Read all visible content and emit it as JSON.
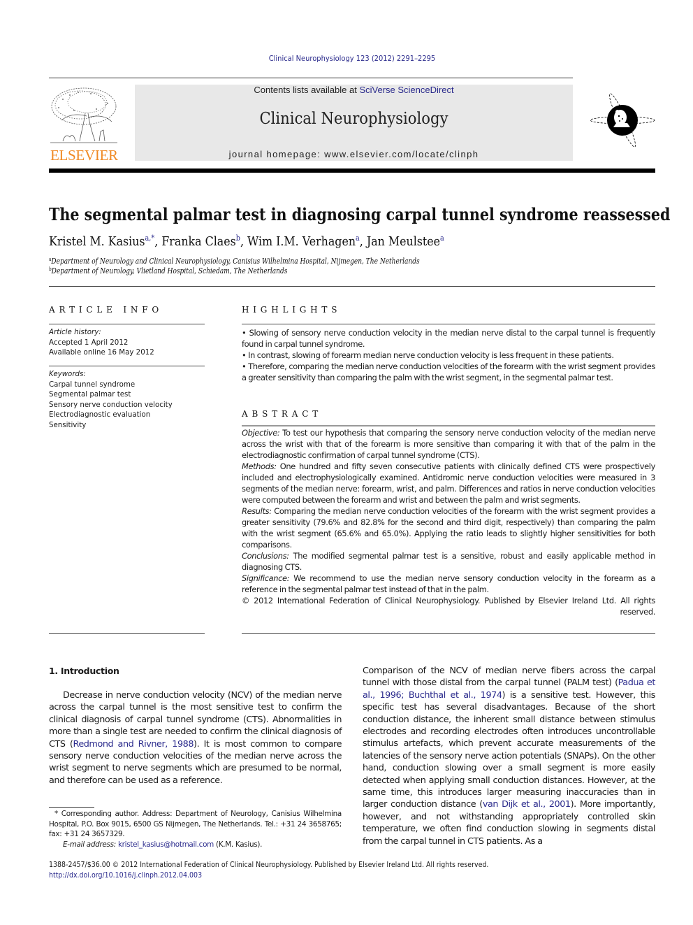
{
  "header": {
    "journal_reference": "Clinical Neurophysiology 123 (2012) 2291–2295",
    "contents_prefix": "Contents lists available at ",
    "contents_link": "SciVerse ScienceDirect",
    "journal_name": "Clinical Neurophysiology",
    "homepage": "journal homepage: www.elsevier.com/locate/clinph",
    "publisher_logo_text": "ELSEVIER",
    "colors": {
      "publisher": "#f08a24",
      "link": "#2a2a8c",
      "banner_bg": "#e8e8e8"
    }
  },
  "article": {
    "title": "The segmental palmar test in diagnosing carpal tunnel syndrome reassessed",
    "authors": [
      {
        "name": "Kristel M. Kasius",
        "sup": "a,*"
      },
      {
        "name": "Franka Claes",
        "sup": "b"
      },
      {
        "name": "Wim I.M. Verhagen",
        "sup": "a"
      },
      {
        "name": "Jan Meulstee",
        "sup": "a"
      }
    ],
    "affiliations": [
      {
        "mark": "a",
        "text": "Department of Neurology and Clinical Neurophysiology, Canisius Wilhelmina Hospital, Nijmegen, The Netherlands"
      },
      {
        "mark": "b",
        "text": "Department of Neurology, Vlietland Hospital, Schiedam, The Netherlands"
      }
    ]
  },
  "article_info": {
    "heading": "ARTICLE INFO",
    "history_label": "Article history:",
    "history": [
      "Accepted 1 April 2012",
      "Available online 16 May 2012"
    ],
    "keywords_label": "Keywords:",
    "keywords": [
      "Carpal tunnel syndrome",
      "Segmental palmar test",
      "Sensory nerve conduction velocity",
      "Electrodiagnostic evaluation",
      "Sensitivity"
    ]
  },
  "highlights": {
    "heading": "HIGHLIGHTS",
    "items": [
      "• Slowing of sensory nerve conduction velocity in the median nerve distal to the carpal tunnel is frequently found in carpal tunnel syndrome.",
      "• In contrast, slowing of forearm median nerve conduction velocity is less frequent in these patients.",
      "• Therefore, comparing the median nerve conduction velocities of the forearm with the wrist segment provides a greater sensitivity than comparing the palm with the wrist segment, in the segmental palmar test."
    ]
  },
  "abstract": {
    "heading": "ABSTRACT",
    "sections": [
      {
        "label": "Objective:",
        "text": " To test our hypothesis that comparing the sensory nerve conduction velocity of the median nerve across the wrist with that of the forearm is more sensitive than comparing it with that of the palm in the electrodiagnostic confirmation of carpal tunnel syndrome (CTS)."
      },
      {
        "label": "Methods:",
        "text": " One hundred and fifty seven consecutive patients with clinically defined CTS were prospectively included and electrophysiologically examined. Antidromic nerve conduction velocities were measured in 3 segments of the median nerve: forearm, wrist, and palm. Differences and ratios in nerve conduction velocities were computed between the forearm and wrist and between the palm and wrist segments."
      },
      {
        "label": "Results:",
        "text": " Comparing the median nerve conduction velocities of the forearm with the wrist segment provides a greater sensitivity (79.6% and 82.8% for the second and third digit, respectively) than comparing the palm with the wrist segment (65.6% and 65.0%). Applying the ratio leads to slightly higher sensitivities for both comparisons."
      },
      {
        "label": "Conclusions:",
        "text": " The modified segmental palmar test is a sensitive, robust and easily applicable method in diagnosing CTS."
      },
      {
        "label": "Significance:",
        "text": " We recommend to use the median nerve sensory conduction velocity in the forearm as a reference in the segmental palmar test instead of that in the palm."
      }
    ],
    "copyright": "© 2012 International Federation of Clinical Neurophysiology. Published by Elsevier Ireland Ltd. All rights reserved."
  },
  "introduction": {
    "heading": "1. Introduction",
    "left_para_parts": [
      "Decrease in nerve conduction velocity (NCV) of the median nerve across the carpal tunnel is the most sensitive test to confirm the clinical diagnosis of carpal tunnel syndrome (CTS). Abnormalities in more than a single test are needed to confirm the clinical diagnosis of CTS (",
      "Redmond and Rivner, 1988",
      "). It is most common to compare sensory nerve conduction velocities of the median nerve across the wrist segment to nerve segments which are presumed to be normal, and therefore can be used as a reference."
    ],
    "right_para_parts": [
      "Comparison of the NCV of median nerve fibers across the carpal tunnel with those distal from the carpal tunnel (PALM test) (",
      "Padua et al., 1996; Buchthal et al., 1974",
      ") is a sensitive test. However, this specific test has several disadvantages. Because of the short conduction distance, the inherent small distance between stimulus electrodes and recording electrodes often introduces uncontrollable stimulus artefacts, which prevent accurate measurements of the latencies of the sensory nerve action potentials (SNAPs). On the other hand, conduction slowing over a small segment is more easily detected when applying small conduction distances. However, at the same time, this introduces larger measuring inaccuracies than in larger conduction distance (",
      "van Dijk et al., 2001",
      "). More importantly, however, and not withstanding appropriately controlled skin temperature, we often find conduction slowing in segments distal from the carpal tunnel in CTS patients. As a"
    ]
  },
  "footnote": {
    "corresponding": "* Corresponding author. Address: Department of Neurology, Canisius Wilhelmina Hospital, P.O. Box 9015, 6500 GS Nijmegen, The Netherlands. Tel.: +31 24 3658765; fax: +31 24 3657329.",
    "email_label": "E-mail address:",
    "email": "kristel_kasius@hotmail.com",
    "email_suffix": " (K.M. Kasius)."
  },
  "bottom": {
    "issn_line": "1388-2457/$36.00 © 2012 International Federation of Clinical Neurophysiology. Published by Elsevier Ireland Ltd. All rights reserved.",
    "doi": "http://dx.doi.org/10.1016/j.clinph.2012.04.003"
  }
}
